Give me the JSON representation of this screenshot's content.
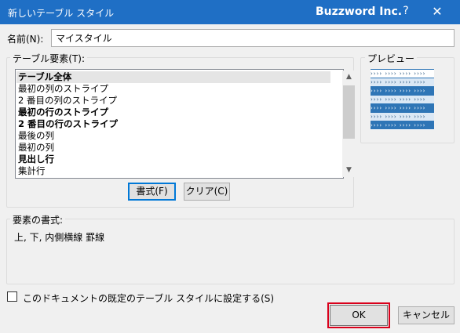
{
  "dialog": {
    "title": "新しいテーブル スタイル",
    "brand": "Buzzword Inc.",
    "help_glyph": "?",
    "close_glyph": "✕"
  },
  "name_field": {
    "label": "名前(N):",
    "value": "マイスタイル"
  },
  "elements_group": {
    "label": "テーブル要素(T):",
    "items": [
      {
        "label": "テーブル全体",
        "bold": true,
        "selected": true
      },
      {
        "label": "最初の列のストライプ",
        "bold": false
      },
      {
        "label": "2 番目の列のストライプ",
        "bold": false
      },
      {
        "label": "最初の行のストライプ",
        "bold": true
      },
      {
        "label": "2 番目の行のストライプ",
        "bold": true
      },
      {
        "label": "最後の列",
        "bold": false
      },
      {
        "label": "最初の列",
        "bold": false
      },
      {
        "label": "見出し行",
        "bold": true
      },
      {
        "label": "集計行",
        "bold": false
      }
    ],
    "format_button": "書式(F)",
    "clear_button": "クリア(C)"
  },
  "preview": {
    "label": "プレビュー",
    "colors": {
      "header": "#ffffff",
      "band_light": "#dbe8f5",
      "band_dark": "#2e75b6",
      "arrow_dark": "#1f4e79",
      "arrow_light": "#ffffff"
    }
  },
  "format_section": {
    "label": "要素の書式:",
    "description": "上, 下, 内側横線 罫線"
  },
  "default_checkbox": {
    "label": "このドキュメントの既定のテーブル スタイルに設定する(S)",
    "checked": false
  },
  "buttons": {
    "ok": "OK",
    "cancel": "キャンセル"
  },
  "icons": {
    "scroll_up": "▲",
    "scroll_down": "▼"
  }
}
